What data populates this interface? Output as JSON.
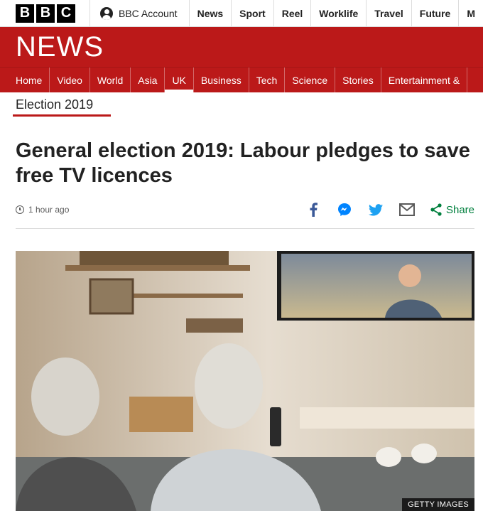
{
  "header": {
    "logo_letters": [
      "B",
      "B",
      "C"
    ],
    "account_label": "BBC Account",
    "nav": [
      "News",
      "Sport",
      "Reel",
      "Worklife",
      "Travel",
      "Future",
      "M"
    ]
  },
  "banner": {
    "title": "NEWS"
  },
  "section_nav": {
    "items": [
      "Home",
      "Video",
      "World",
      "Asia",
      "UK",
      "Business",
      "Tech",
      "Science",
      "Stories",
      "Entertainment &"
    ],
    "active": "UK"
  },
  "article": {
    "tag": "Election 2019",
    "headline": "General election 2019: Labour pledges to save free TV licences",
    "timestamp": "1 hour ago",
    "share_label": "Share",
    "image_credit": "GETTY IMAGES"
  },
  "colors": {
    "brand_red": "#bb1919",
    "facebook": "#3b5998",
    "messenger": "#0084ff",
    "twitter": "#1da1f2",
    "share_green": "#007f3d"
  }
}
